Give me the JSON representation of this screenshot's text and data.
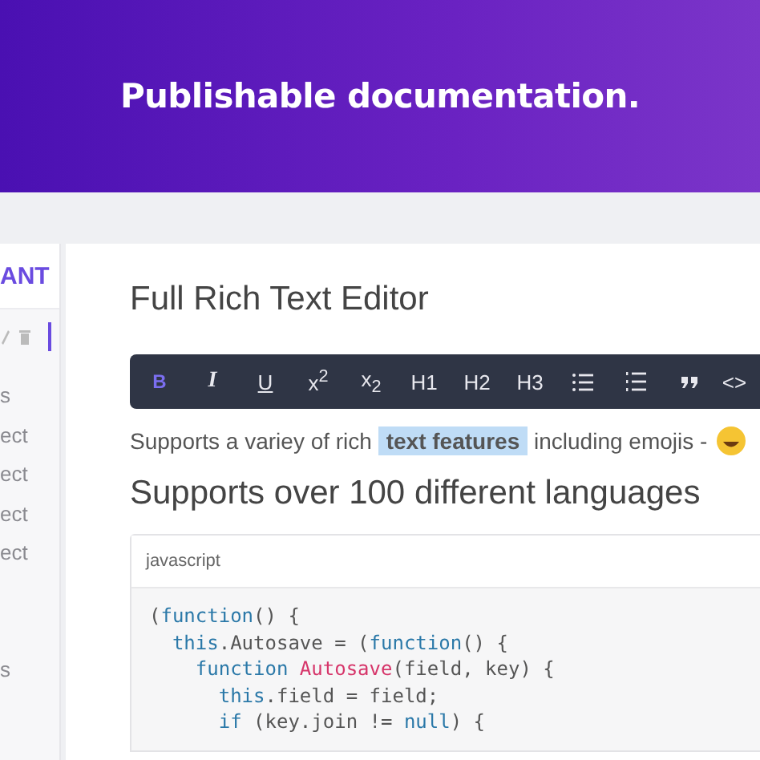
{
  "banner": {
    "title": "Publishable documentation."
  },
  "sidebar": {
    "brand": "ANT",
    "groups": [
      {
        "items": [
          {
            "label": "s"
          },
          {
            "label": "ect"
          },
          {
            "label": "ect"
          },
          {
            "label": "ect"
          },
          {
            "label": "ect"
          }
        ]
      },
      {
        "items": [
          {
            "label": "s"
          }
        ]
      }
    ]
  },
  "editor": {
    "title": "Full Rich Text Editor",
    "toolbar": [
      {
        "kind": "bold",
        "label": "B",
        "active": true
      },
      {
        "kind": "italic",
        "label": "I",
        "active": false
      },
      {
        "kind": "underline",
        "label": "U",
        "active": false
      },
      {
        "kind": "text",
        "label": "x$^{2}$",
        "active": false
      },
      {
        "kind": "text",
        "label": "x$_{2}$",
        "active": false
      },
      {
        "kind": "text",
        "label": "H1",
        "active": false
      },
      {
        "kind": "text",
        "label": "H2",
        "active": false
      },
      {
        "kind": "text",
        "label": "H3",
        "active": false
      },
      {
        "kind": "bullets",
        "active": false
      },
      {
        "kind": "numbers",
        "active": false
      },
      {
        "kind": "quote",
        "active": false
      },
      {
        "kind": "text",
        "label": "<>",
        "active": false
      }
    ],
    "paragraph": {
      "before": "Supports a variey of rich ",
      "highlight": "text features",
      "after": " including emojis - "
    },
    "heading": "Supports over 100 different languages",
    "code": {
      "language": "javascript",
      "lines": [
        [
          {
            "kind": "plain",
            "text": "("
          },
          {
            "kind": "keyword",
            "text": "function"
          },
          {
            "kind": "plain",
            "text": "() {"
          }
        ],
        [
          {
            "kind": "keyword",
            "text": "  this"
          },
          {
            "kind": "plain",
            "text": ".Autosave = ("
          },
          {
            "kind": "keyword",
            "text": "function"
          },
          {
            "kind": "plain",
            "text": "() {"
          }
        ],
        [
          {
            "kind": "keyword",
            "text": "    function "
          },
          {
            "kind": "name",
            "text": "Autosave"
          },
          {
            "kind": "plain",
            "text": "(field, key) {"
          }
        ],
        [
          {
            "kind": "keyword",
            "text": "      this"
          },
          {
            "kind": "plain",
            "text": ".field = field;"
          }
        ],
        [
          {
            "kind": "keyword",
            "text": "      if"
          },
          {
            "kind": "plain",
            "text": " (key.join != "
          },
          {
            "kind": "keyword",
            "text": "null"
          },
          {
            "kind": "plain",
            "text": ") {"
          }
        ]
      ]
    }
  }
}
